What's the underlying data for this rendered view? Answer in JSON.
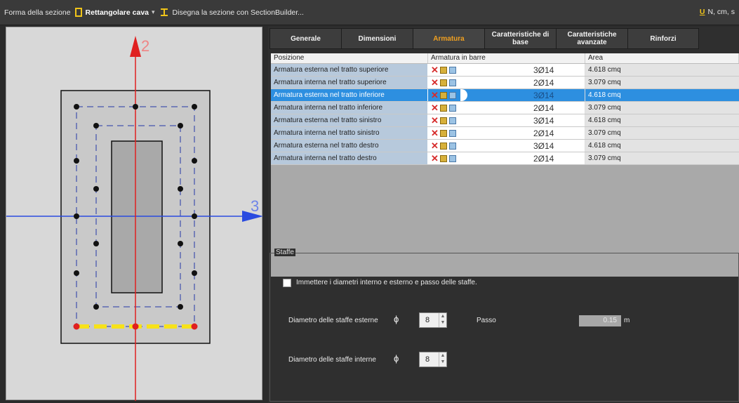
{
  "toolbar": {
    "section_shape_label": "Forma della sezione",
    "section_shape_value": "Rettangolare cava",
    "caret": "▾",
    "draw_link": "Disegna la sezione con SectionBuilder...",
    "units_key": "U",
    "units_value": "N, cm, s"
  },
  "drawing": {
    "axis_vertical_label": "2",
    "axis_horizontal_label": "3"
  },
  "tabs": [
    {
      "label": "Generale"
    },
    {
      "label": "Dimensioni"
    },
    {
      "label": "Armatura"
    },
    {
      "label": "Caratteristiche di base"
    },
    {
      "label": "Caratteristiche avanzate"
    },
    {
      "label": "Rinforzi"
    }
  ],
  "active_tab": "Armatura",
  "table": {
    "headers": [
      "Posizione",
      "Armatura in barre",
      "Area"
    ],
    "rows": [
      {
        "position": "Armatura esterna nel tratto superiore",
        "bars": "3Ø14",
        "area": "4.618 cmq"
      },
      {
        "position": "Armatura interna nel tratto superiore",
        "bars": "2Ø14",
        "area": "3.079 cmq"
      },
      {
        "position": "Armatura esterna nel tratto inferiore",
        "bars": "3Ø14",
        "area": "4.618 cmq"
      },
      {
        "position": "Armatura interna nel tratto inferiore",
        "bars": "2Ø14",
        "area": "3.079 cmq"
      },
      {
        "position": "Armatura esterna nel tratto sinistro",
        "bars": "3Ø14",
        "area": "4.618 cmq"
      },
      {
        "position": "Armatura interna nel tratto sinistro",
        "bars": "2Ø14",
        "area": "3.079 cmq"
      },
      {
        "position": "Armatura esterna nel tratto destro",
        "bars": "3Ø14",
        "area": "4.618 cmq"
      },
      {
        "position": "Armatura interna nel tratto destro",
        "bars": "2Ø14",
        "area": "3.079 cmq"
      }
    ],
    "selected_row": "Armatura esterna nel tratto inferiore"
  },
  "staffe": {
    "legend": "Staffe",
    "checkbox_label": "Immettere i diametri interno e esterno e passo delle staffe.",
    "checkbox_checked": false,
    "phi_symbol": "ϕ",
    "external_label": "Diametro delle staffe esterne",
    "external_value": "8",
    "internal_label": "Diametro delle staffe interne",
    "internal_value": "8",
    "passo_label": "Passo",
    "passo_value": "0.15",
    "passo_unit": "m"
  },
  "colors": {
    "accent_tab": "#f0a020",
    "selection": "#2d8fe0",
    "axis_vertical": "#e02020",
    "axis_horizontal": "#2a4be0",
    "highlight_bar": "#f7e21a"
  }
}
